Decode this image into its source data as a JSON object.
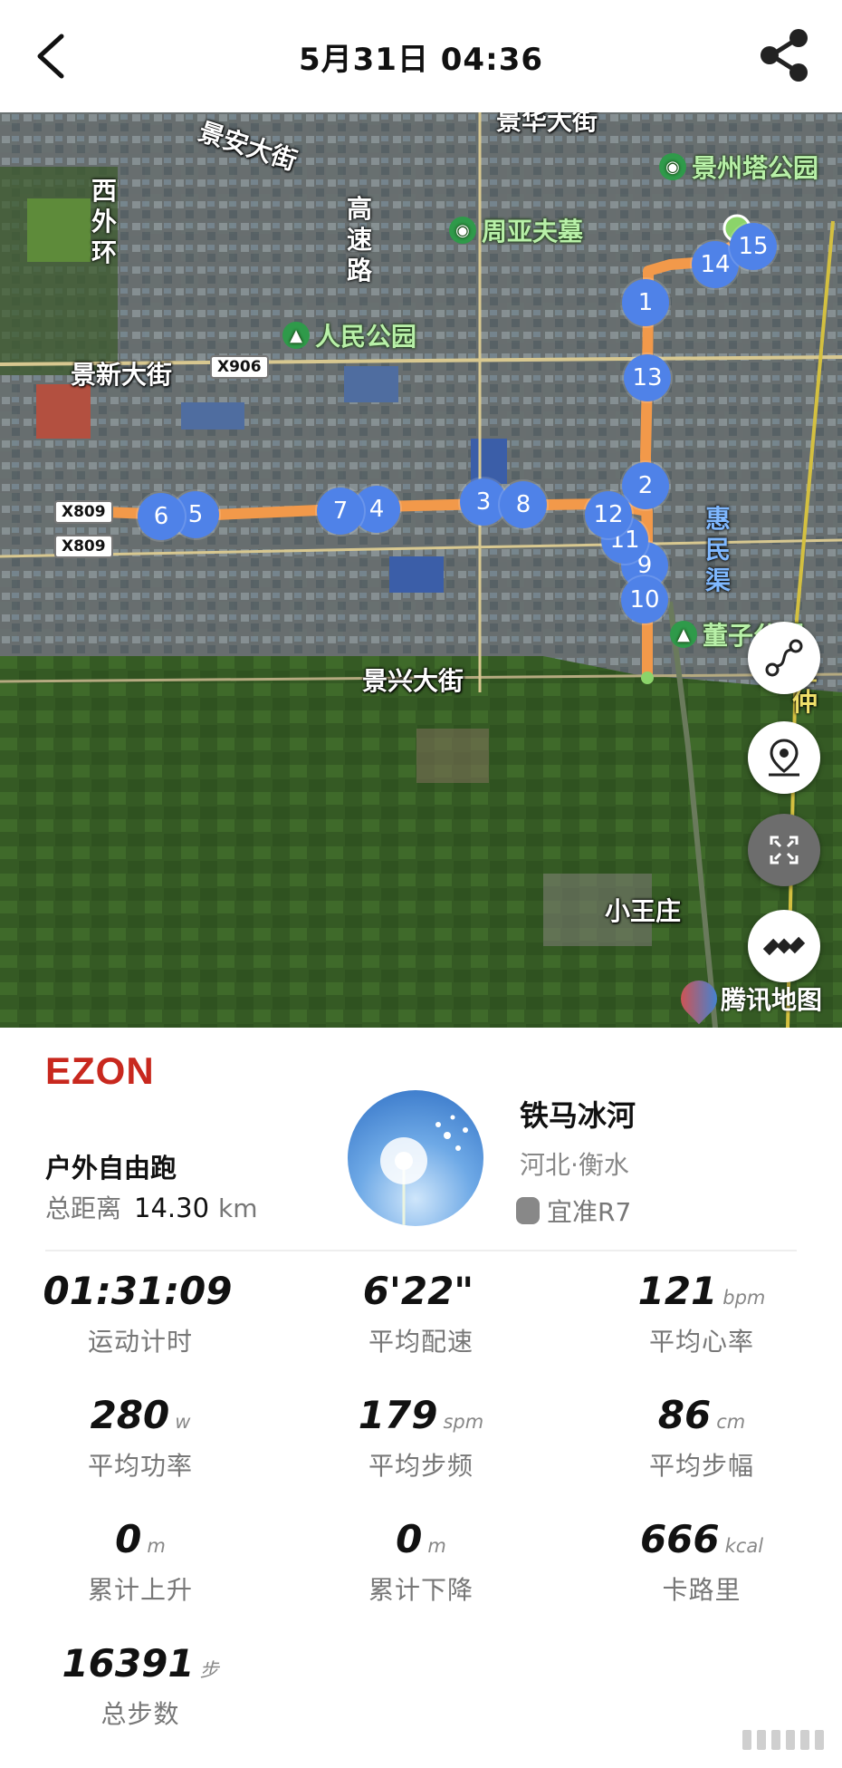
{
  "header": {
    "title": "5月31日 04:36",
    "back_icon": "back-arrow-icon",
    "share_icon": "share-icon"
  },
  "map": {
    "roads": [
      "景安大街",
      "景华大街",
      "景新大街",
      "景兴大街",
      "西外环",
      "高速路"
    ],
    "road_badges": [
      "X906",
      "X809",
      "X809"
    ],
    "pois": [
      "景州塔公园",
      "周亚夫墓",
      "人民公园",
      "董子公园"
    ],
    "places": [
      "小王庄",
      "惠民渠",
      "宜仲"
    ],
    "markers": [
      "1",
      "2",
      "3",
      "4",
      "5",
      "6",
      "7",
      "8",
      "9",
      "10",
      "11",
      "12",
      "13",
      "14",
      "15"
    ],
    "provider": "腾讯地图",
    "route_color": "#f2994a",
    "marker_color": "#4f82e8"
  },
  "summary": {
    "brand": "EZON",
    "sport": "户外自由跑",
    "distance_label": "总距离",
    "distance_value": "14.30",
    "distance_unit": "km",
    "user_name": "铁马冰河",
    "location": "河北·衡水",
    "device": "宜准R7"
  },
  "stats": [
    {
      "value": "01:31:09",
      "unit": "",
      "label": "运动计时"
    },
    {
      "value": "6'22\"",
      "unit": "",
      "label": "平均配速"
    },
    {
      "value": "121",
      "unit": "bpm",
      "label": "平均心率"
    },
    {
      "value": "280",
      "unit": "w",
      "label": "平均功率"
    },
    {
      "value": "179",
      "unit": "spm",
      "label": "平均步频"
    },
    {
      "value": "86",
      "unit": "cm",
      "label": "平均步幅"
    },
    {
      "value": "0",
      "unit": "m",
      "label": "累计上升"
    },
    {
      "value": "0",
      "unit": "m",
      "label": "累计下降"
    },
    {
      "value": "666",
      "unit": "kcal",
      "label": "卡路里"
    },
    {
      "value": "16391",
      "unit": "步",
      "label": "总步数"
    }
  ]
}
